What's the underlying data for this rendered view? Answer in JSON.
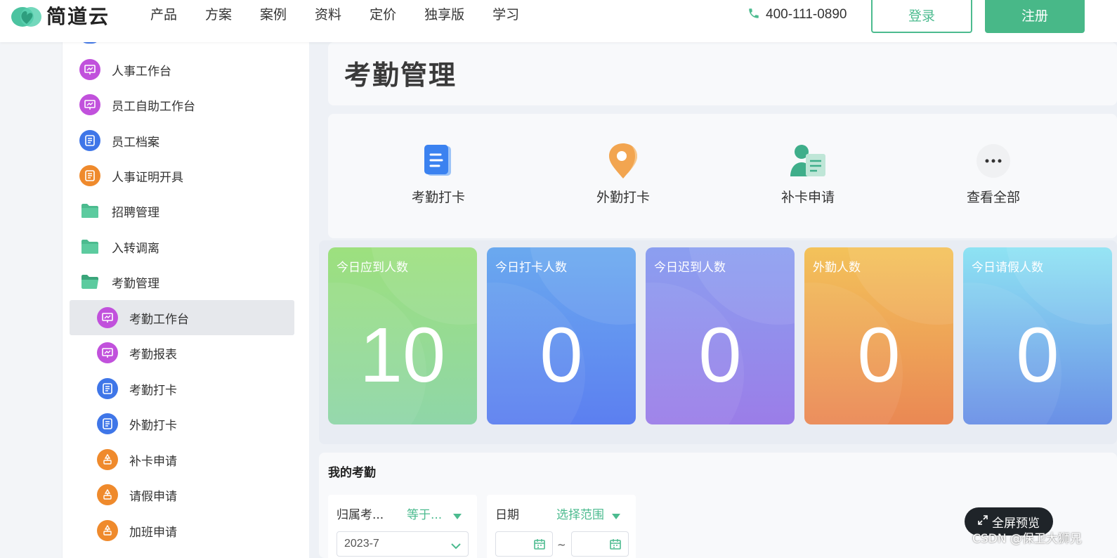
{
  "header": {
    "logo_text": "简道云",
    "nav": [
      "产品",
      "方案",
      "案例",
      "资料",
      "定价",
      "独享版",
      "学习"
    ],
    "phone": "400-111-0890",
    "login": "登录",
    "register": "注册"
  },
  "sidebar": {
    "items": [
      {
        "label": "人事工作台",
        "icon": "chart-board-icon",
        "color": "#c151dc"
      },
      {
        "label": "员工自助工作台",
        "icon": "chart-board-icon",
        "color": "#c151dc"
      },
      {
        "label": "员工档案",
        "icon": "document-icon",
        "color": "#3f76e8"
      },
      {
        "label": "人事证明开具",
        "icon": "document-icon",
        "color": "#ef8a2c"
      },
      {
        "label": "招聘管理",
        "icon": "folder-icon",
        "color": "#4cbb8f"
      },
      {
        "label": "入转调离",
        "icon": "folder-icon",
        "color": "#4cbb8f"
      },
      {
        "label": "考勤管理",
        "icon": "folder-open-icon",
        "color": "#4cbb8f"
      },
      {
        "label": "考勤工作台",
        "icon": "chart-board-icon",
        "color": "#c151dc"
      },
      {
        "label": "考勤报表",
        "icon": "chart-board-icon",
        "color": "#c151dc"
      },
      {
        "label": "考勤打卡",
        "icon": "document-icon",
        "color": "#3f76e8"
      },
      {
        "label": "外勤打卡",
        "icon": "document-icon",
        "color": "#3f76e8"
      },
      {
        "label": "补卡申请",
        "icon": "flow-icon",
        "color": "#ef8a2c"
      },
      {
        "label": "请假申请",
        "icon": "flow-icon",
        "color": "#ef8a2c"
      },
      {
        "label": "加班申请",
        "icon": "flow-icon",
        "color": "#ef8a2c"
      }
    ]
  },
  "main": {
    "title": "考勤管理",
    "quick_actions": [
      {
        "label": "考勤打卡",
        "icon": "clipboard-icon"
      },
      {
        "label": "外勤打卡",
        "icon": "location-pin-icon"
      },
      {
        "label": "补卡申请",
        "icon": "user-card-icon"
      },
      {
        "label": "查看全部",
        "icon": "more-icon"
      }
    ],
    "stats": [
      {
        "label": "今日应到人数",
        "value": "10",
        "colors": [
          "#9de07e",
          "#8fd6a8"
        ]
      },
      {
        "label": "今日打卡人数",
        "value": "0",
        "colors": [
          "#6aa9ef",
          "#5c7ff0"
        ]
      },
      {
        "label": "今日迟到人数",
        "value": "0",
        "colors": [
          "#8b9ff0",
          "#9b7de8"
        ]
      },
      {
        "label": "外勤人数",
        "value": "0",
        "colors": [
          "#f3c25a",
          "#ea8854"
        ]
      },
      {
        "label": "今日请假人数",
        "value": "0",
        "colors": [
          "#8ee3f3",
          "#6a8fe6"
        ]
      }
    ],
    "my_attendance": {
      "title": "我的考勤",
      "filter1": {
        "label": "归属考...",
        "op": "等于...",
        "value": "2023-7"
      },
      "filter2": {
        "label": "日期",
        "op": "选择范围",
        "separator": "~"
      }
    }
  },
  "overlay": {
    "preview": "全屏预览",
    "watermark": "CSDN @保卫大狮兄"
  }
}
